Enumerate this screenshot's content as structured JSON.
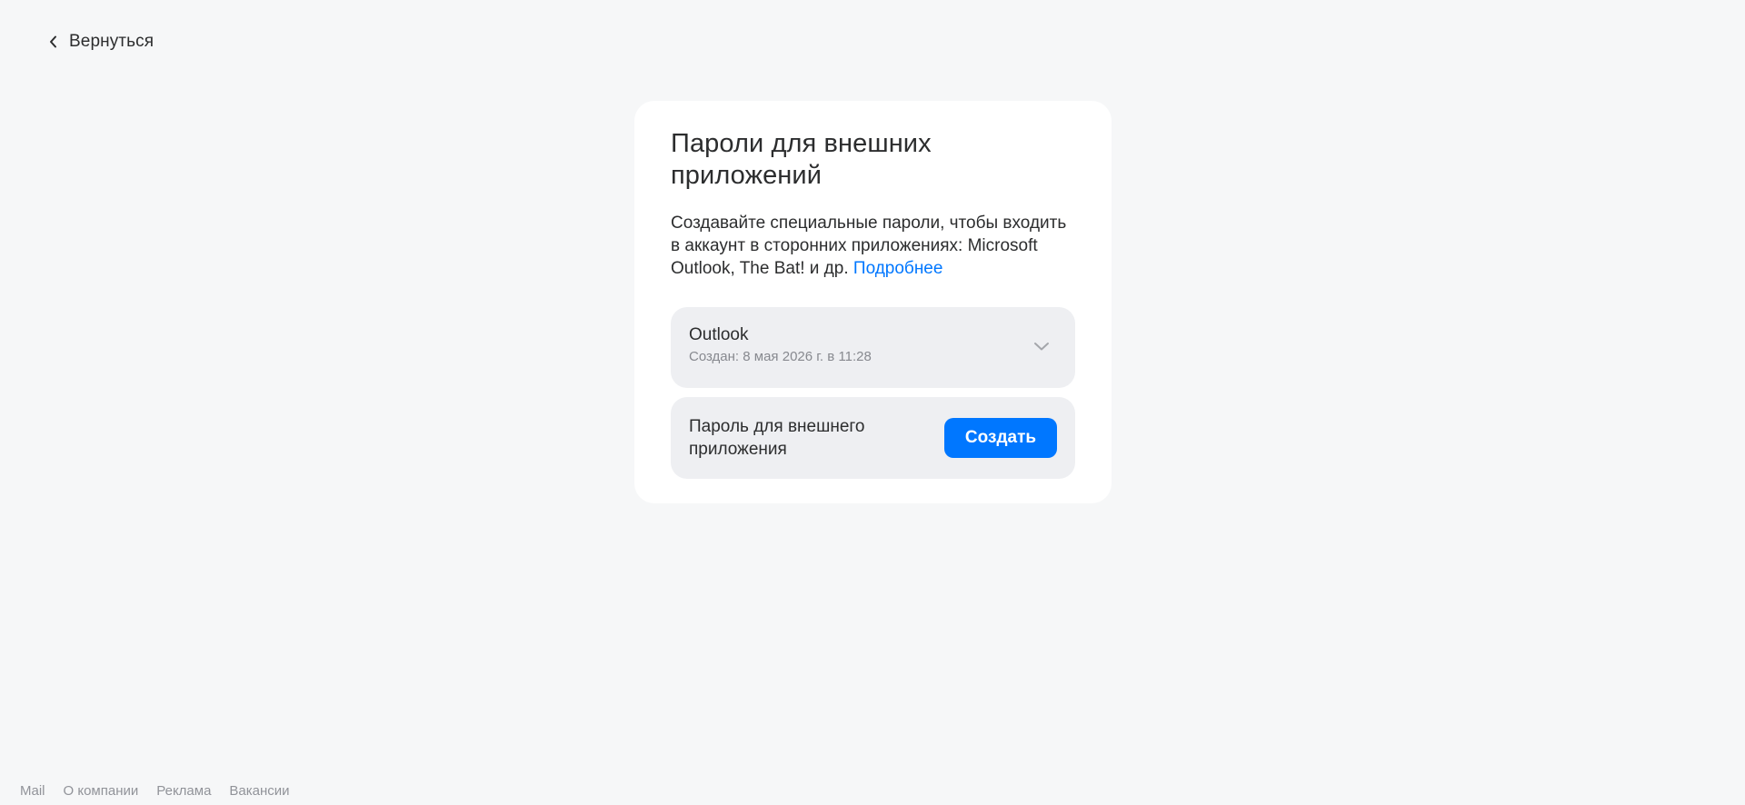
{
  "nav": {
    "back_label": "Вернуться"
  },
  "card": {
    "title": "Пароли для внешних приложений",
    "description": "Создавайте специальные пароли, чтобы входить в аккаунт в сторонних приложениях: Microsoft Outlook, The Bat! и др.",
    "more_link": "Подробнее",
    "passwords": [
      {
        "name": "Outlook",
        "created": "Создан: 8 мая 2026 г. в 11:28"
      }
    ],
    "create_label": "Пароль для внешнего приложения",
    "create_button": "Создать"
  },
  "footer": {
    "links": [
      "Mail",
      "О компании",
      "Реклама",
      "Вакансии"
    ]
  },
  "colors": {
    "background": "#f6f7f8",
    "card": "#ffffff",
    "item_bg": "#eeeff2",
    "accent": "#0077ff",
    "text": "#2c2d2e",
    "muted": "#87898f"
  },
  "icons": {
    "back": "chevron-left-icon",
    "expand": "chevron-down-icon"
  }
}
